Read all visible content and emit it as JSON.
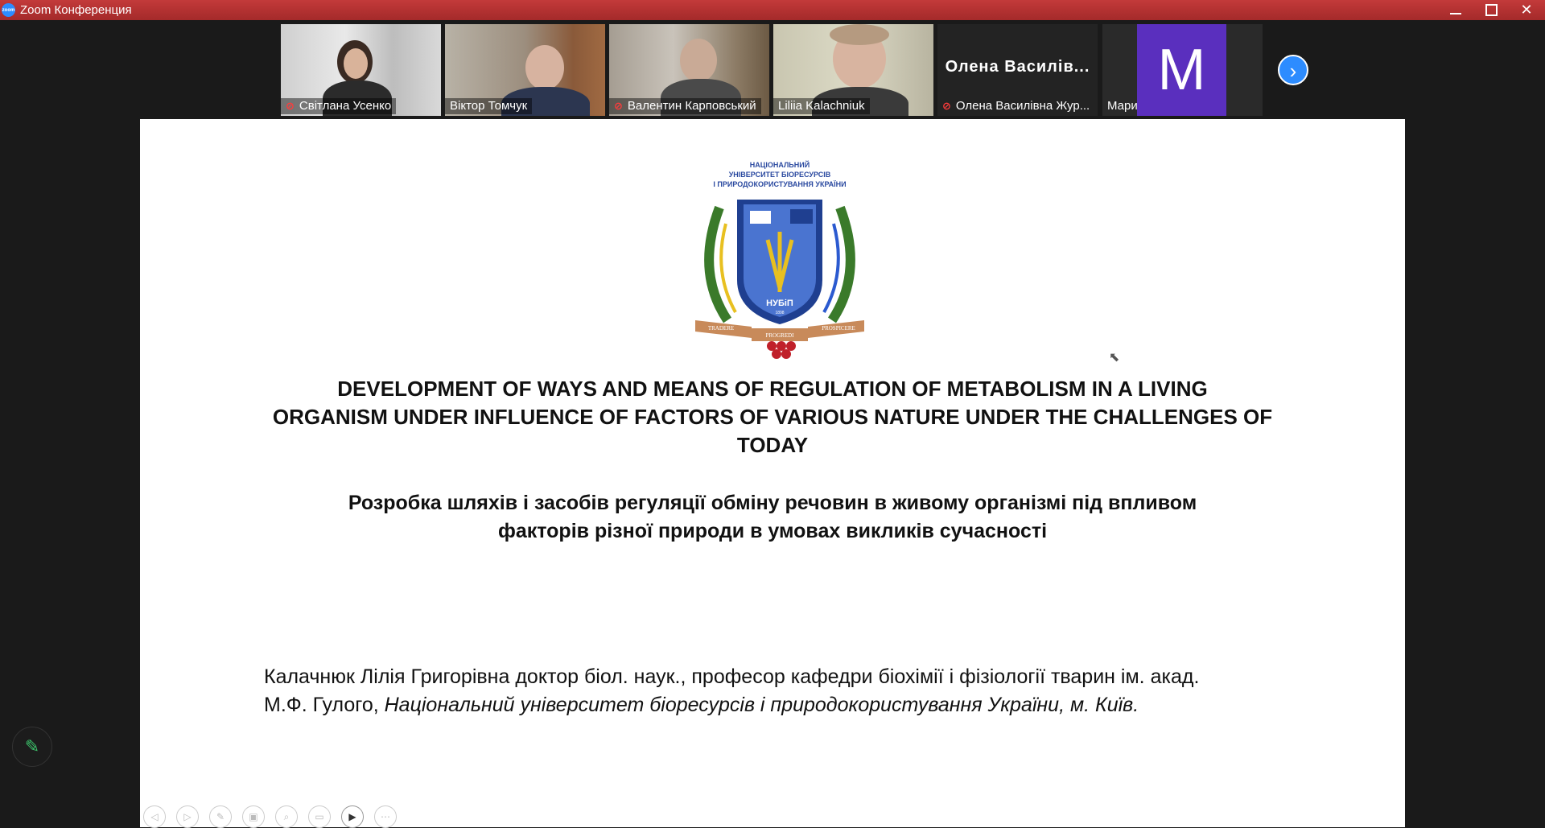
{
  "window": {
    "title": "Zoom Конференция",
    "logo_text": "zoom"
  },
  "participants": [
    {
      "name": "Світлана Усенко",
      "muted": true,
      "active": false
    },
    {
      "name": "Віктор Томчук",
      "muted": false,
      "active": false
    },
    {
      "name": "Валентин Карповський",
      "muted": true,
      "active": false
    },
    {
      "name": "Liliia Kalachniuk",
      "muted": false,
      "active": true
    },
    {
      "name": "Олена Василівна Жур...",
      "muted": true,
      "active": false,
      "tile_text": "Олена  Василів..."
    },
    {
      "name": "Мария Камбур",
      "muted": false,
      "active": false,
      "avatar_letter": "M"
    }
  ],
  "colors": {
    "titlebar": "#b33333",
    "accent": "#2d8cff",
    "avatar_bg": "#5a2fbe",
    "active_border": "#9acd32",
    "annotate_icon": "#3cc26b"
  },
  "slide": {
    "emblem_text_line1": "НАЦІОНАЛЬНИЙ",
    "emblem_text_line2": "УНІВЕРСИТЕТ БІОРЕСУРСІВ",
    "emblem_text_line3": "І ПРИРОДОКОРИСТУВАННЯ УКРАЇНИ",
    "emblem_center": "НУБіП",
    "emblem_year": "1898",
    "ribbon_left": "TRADERE",
    "ribbon_center": "PROGREDI",
    "ribbon_right": "PROSPICERE",
    "title_en_line1": "DEVELOPMENT OF WAYS AND MEANS OF REGULATION OF METABOLISM IN A LIVING",
    "title_en_line2": "ORGANISM UNDER INFLUENCE OF FACTORS OF VARIOUS NATURE UNDER THE CHALLENGES OF",
    "title_en_line3": "TODAY",
    "title_ua_line1": "Розробка шляхів і засобів регуляції обміну речовин в живому організмі під впливом",
    "title_ua_line2": "факторів різної природи в умовах викликів сучасності",
    "author_line1": "Калачнюк Лілія Григорівна доктор біол. наук., професор кафедри біохімії і фізіології тварин ім. акад.",
    "author_line2_plain": "М.Ф. Гулого, ",
    "author_line2_italic": "Національний університет біоресурсів і природокористування України, м. Київ."
  },
  "toolbar_icons": [
    "prev-icon",
    "next-icon",
    "pen-icon",
    "copy-icon",
    "zoom-icon",
    "image-icon",
    "video-icon",
    "more-icon"
  ]
}
